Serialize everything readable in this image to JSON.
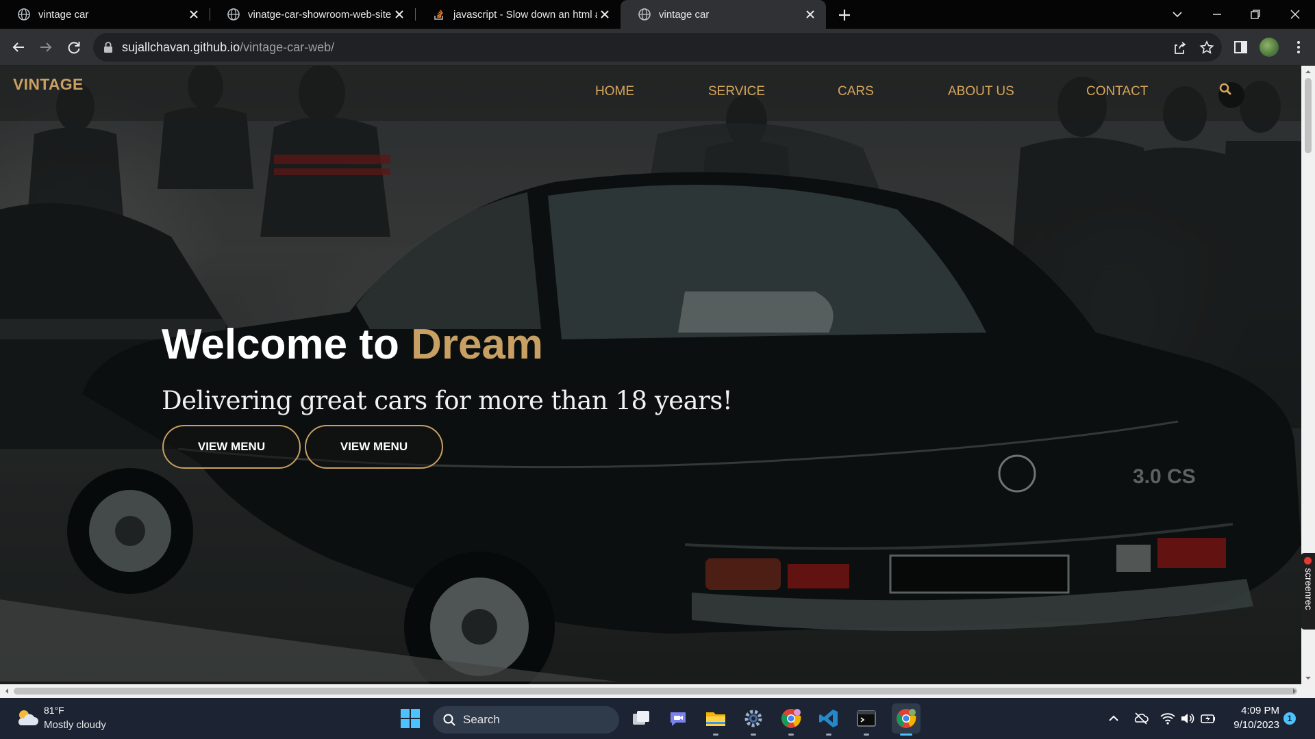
{
  "browser": {
    "tabs": [
      {
        "title": "vintage car",
        "icon": "globe-icon"
      },
      {
        "title": "vinatge-car-showroom-web-site",
        "icon": "globe-icon"
      },
      {
        "title": "javascript - Slow down an html ar",
        "icon": "stackoverflow-icon"
      },
      {
        "title": "vintage car",
        "icon": "globe-icon",
        "active": true
      }
    ],
    "url_host": "sujallchavan.github.io",
    "url_path": "/vintage-car-web/"
  },
  "site": {
    "logo": "VINTAGE",
    "nav": [
      "HOME",
      "SERVICE",
      "CARS",
      "ABOUT US",
      "CONTACT"
    ],
    "hero": {
      "title_main": "Welcome to ",
      "title_accent": "Dream",
      "subtitle": "Delivering great cars for more than 18 years!",
      "buttons": [
        "VIEW MENU",
        "VIEW MENU"
      ]
    },
    "colors": {
      "accent": "#c9a063",
      "nav_text": "#d6a75b"
    }
  },
  "side_badge": "screenrec",
  "taskbar": {
    "weather": {
      "temp": "81°F",
      "desc": "Mostly cloudy"
    },
    "search_label": "Search",
    "apps": [
      "windows-start-icon",
      "task-view-icon",
      "teams-chat-icon",
      "file-explorer-icon",
      "settings-icon",
      "chrome-icon",
      "vscode-icon",
      "terminal-icon",
      "chrome-icon"
    ],
    "clock": {
      "time": "4:09 PM",
      "date": "9/10/2023"
    },
    "notification_count": "1"
  }
}
